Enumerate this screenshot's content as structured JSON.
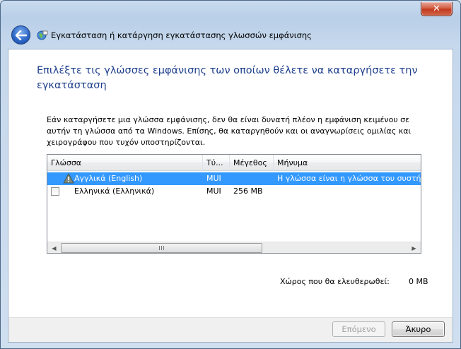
{
  "window": {
    "title": "Εγκατάσταση ή κατάργηση εγκατάστασης γλωσσών εμφάνισης",
    "close_label": "✕"
  },
  "main": {
    "instruction": "Επιλέξτε τις γλώσσες εμφάνισης των οποίων θέλετε να καταργήσετε την εγκατάσταση",
    "description": "Εάν καταργήσετε μια γλώσσα εμφάνισης, δεν θα είναι δυνατή πλέον η εμφάνιση κειμένου σε αυτήν τη γλώσσα από τα Windows. Επίσης, θα καταργηθούν και οι αναγνωρίσεις ομιλίας και χειρογράφου που τυχόν υποστηρίζονται."
  },
  "list": {
    "columns": {
      "language": "Γλώσσα",
      "type": "Τύ...",
      "size": "Μέγεθος",
      "message": "Μήνυμα"
    },
    "rows": [
      {
        "language": "Αγγλικά (English)",
        "type": "MUI",
        "size": "",
        "message": "Η γλώσσα είναι η γλώσσα του συστήματος",
        "selected": true,
        "icon": "warning-icon"
      },
      {
        "language": "Ελληνικά (Ελληνικά)",
        "type": "MUI",
        "size": "256 MB",
        "message": "",
        "selected": false,
        "checked": false
      }
    ]
  },
  "space": {
    "label": "Χώρος που θα ελευθερωθεί:",
    "value": "0 MB"
  },
  "buttons": {
    "next": "Επόμενο",
    "cancel": "Άκυρο"
  },
  "colors": {
    "accent": "#1e3f8c",
    "selection": "#3399ff"
  }
}
